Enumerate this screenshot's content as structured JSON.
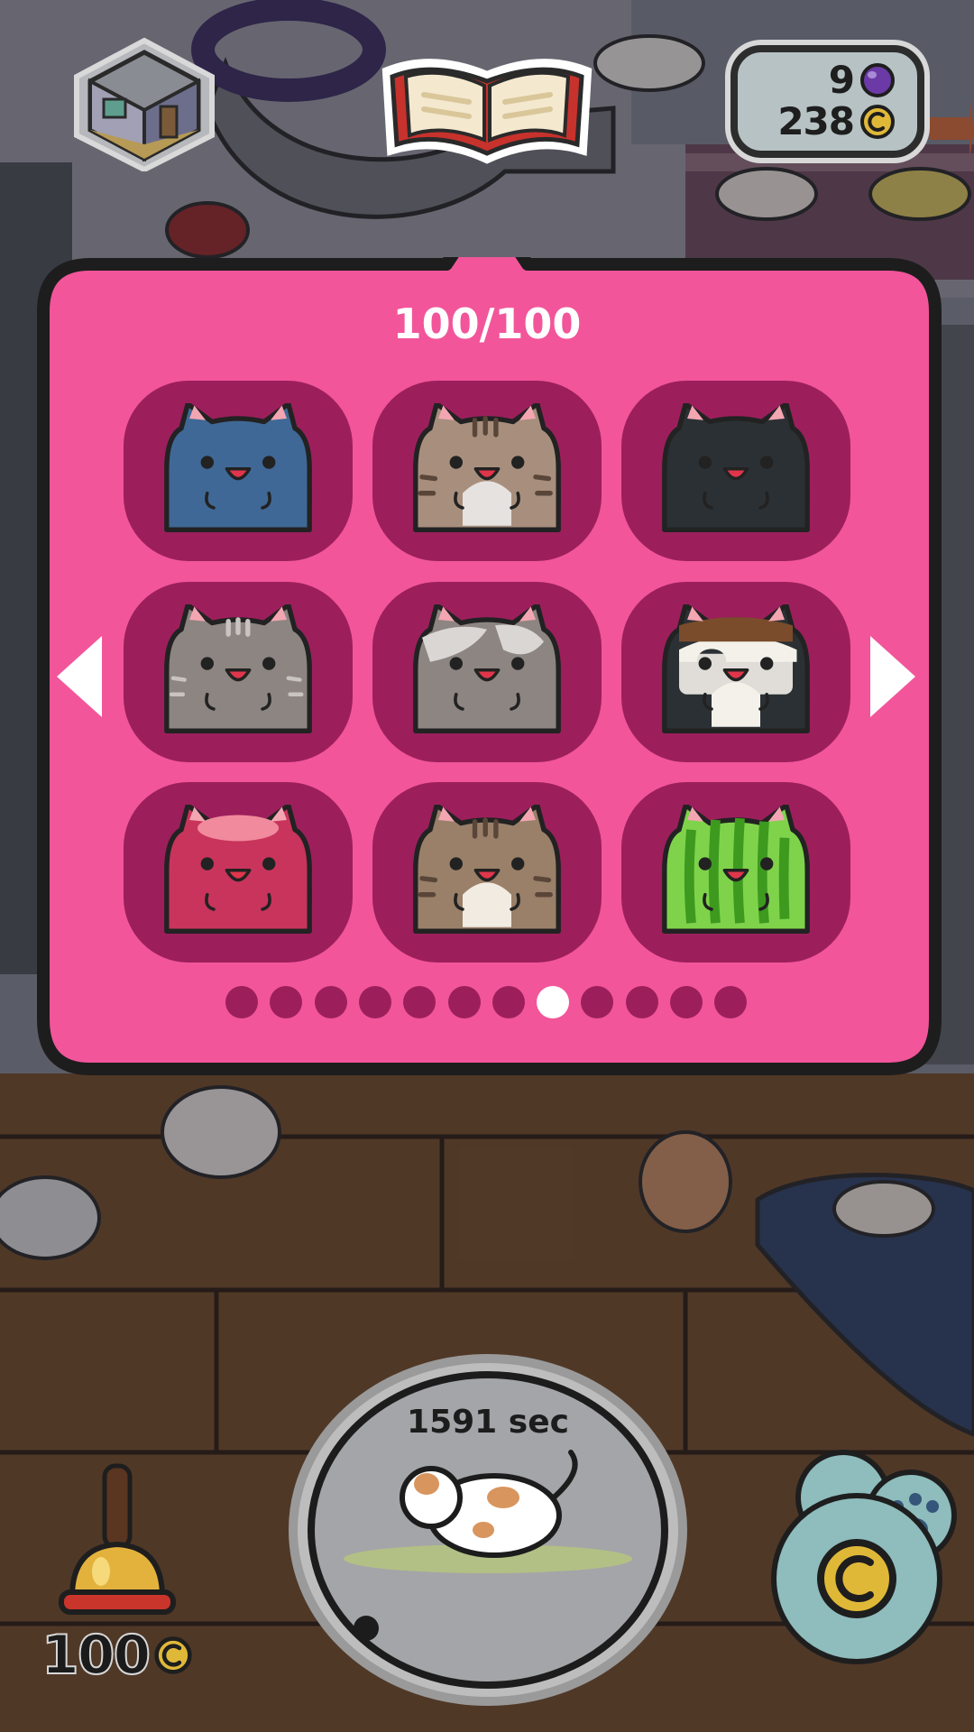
{
  "currency": {
    "gems": "9",
    "coins": "238"
  },
  "collection": {
    "count_text": "100/100",
    "cats": [
      {
        "name": "blue-cat",
        "body": "#3f6896",
        "belly": "#3f6896",
        "pattern": "plain"
      },
      {
        "name": "brown-tabby-cat",
        "body": "#a88f7d",
        "belly": "#e6e2e0",
        "pattern": "tabby"
      },
      {
        "name": "black-cat",
        "body": "#2b3034",
        "belly": "#2b3034",
        "pattern": "plain"
      },
      {
        "name": "grey-tabby-cat",
        "body": "#8d8581",
        "belly": "#8d8581",
        "pattern": "grey-tabby"
      },
      {
        "name": "grey-white-patch-cat",
        "body": "#8d8581",
        "belly": "#8d8581",
        "pattern": "patch"
      },
      {
        "name": "pirate-eyepatch-cat",
        "body": "#2b3034",
        "belly": "#f4f1ea",
        "pattern": "pirate"
      },
      {
        "name": "red-jelly-cat",
        "body": "#c9345c",
        "belly": "#c9345c",
        "pattern": "jelly"
      },
      {
        "name": "brown-tabby-white-chest-cat",
        "body": "#9a8069",
        "belly": "#f1ebe2",
        "pattern": "tabby2"
      },
      {
        "name": "watermelon-cat",
        "body": "#7fd34b",
        "belly": "#7fd34b",
        "pattern": "melon"
      }
    ],
    "pages_total": 12,
    "current_page": 8
  },
  "bell": {
    "price": "100"
  },
  "timer": {
    "text": "1591 sec"
  },
  "colors": {
    "popup_pink": "#f2559a",
    "slot_dark": "#9c1f5c",
    "outline": "#222222"
  }
}
